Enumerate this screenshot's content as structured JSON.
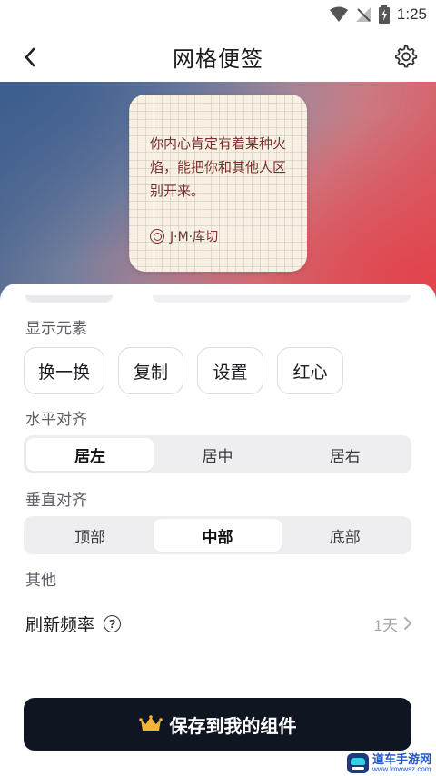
{
  "status_bar": {
    "time": "1:25",
    "icons": [
      "wifi-icon",
      "signal-off-icon",
      "battery-charging-icon"
    ]
  },
  "app_bar": {
    "title": "网格便签",
    "back_icon": "chevron-left-icon",
    "settings_icon": "gear-icon"
  },
  "preview": {
    "note_text": "你内心肯定有着某种火焰，能把你和其他人区别开来。",
    "signature": "J·M·库切",
    "signature_icon": "target-circle-icon",
    "colors": {
      "text": "#7a2e2e",
      "paper": "#f6f1e4"
    }
  },
  "display_elements": {
    "label": "显示元素",
    "buttons": [
      "换一换",
      "复制",
      "设置",
      "红心"
    ]
  },
  "horizontal_align": {
    "label": "水平对齐",
    "options": [
      "居左",
      "居中",
      "居右"
    ],
    "selected": "居左"
  },
  "vertical_align": {
    "label": "垂直对齐",
    "options": [
      "顶部",
      "中部",
      "底部"
    ],
    "selected": "中部"
  },
  "other": {
    "label": "其他",
    "refresh_label": "刷新频率",
    "refresh_value": "1天",
    "help_icon": "question-circle-icon"
  },
  "save_button": {
    "label": "保存到我的组件",
    "icon": "crown-icon",
    "background": "#0f1621",
    "icon_color": "#f2b53a"
  },
  "watermark": {
    "main": "道车手游网",
    "sub": "www.lmwwsz.com"
  }
}
